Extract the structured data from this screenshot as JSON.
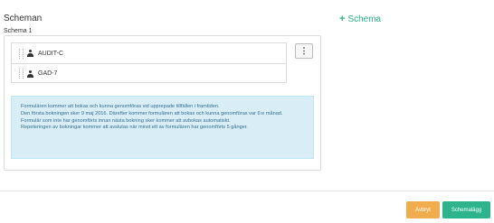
{
  "header": {
    "title": "Scheman",
    "add_label": "Schema",
    "sub_label": "Schema 1"
  },
  "forms": [
    {
      "label": "AUDIT-C",
      "icon": "person-icon"
    },
    {
      "label": "GAD-7",
      "icon": "person-icon"
    }
  ],
  "menu_button": {
    "label": "⋮"
  },
  "info": {
    "lines": [
      "Formulären kommer att bokas och kunna genomföras vid upprepade tillfällen i framtiden.",
      "Den första bokningen sker 9 maj 2016. Därefter kommer formulären att bokas och kunna genomföras var 6:e månad. Formulär som inte har genomförts innan nästa bokning sker kommer att avbokas automatiskt.",
      "Repeteringen av bokningar kommer att avslutas när minst ett av formulären har genomförts 5 gånger."
    ]
  },
  "footer": {
    "cancel_label": "Avbryt",
    "save_label": "Schemalägg"
  },
  "colors": {
    "accent": "#2db48d",
    "warning": "#f0ad4e",
    "info_bg": "#d9edf7",
    "info_text": "#31708f"
  }
}
